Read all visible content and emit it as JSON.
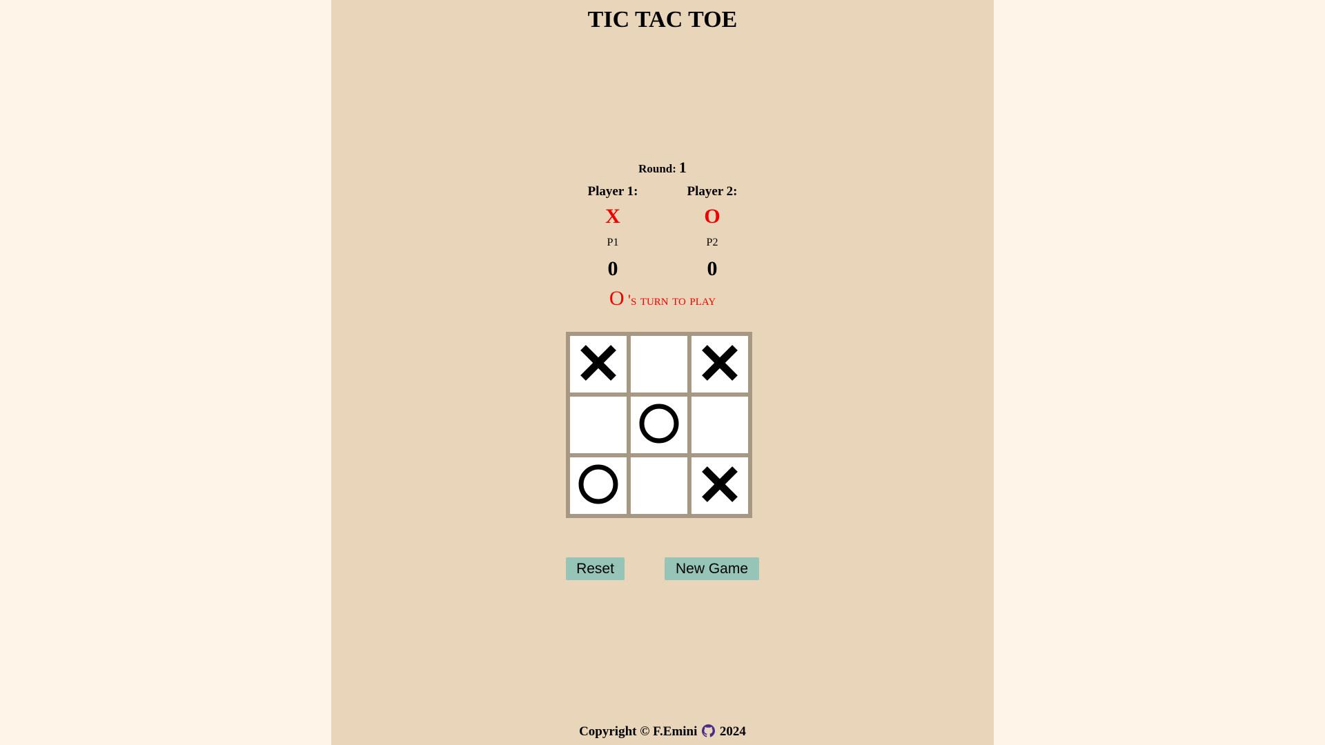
{
  "title": "TIC TAC TOE",
  "round": {
    "label": "Round:",
    "value": "1"
  },
  "players": [
    {
      "label": "Player 1:",
      "symbol": "X",
      "name": "P1",
      "score": "0"
    },
    {
      "label": "Player 2:",
      "symbol": "O",
      "name": "P2",
      "score": "0"
    }
  ],
  "turn": {
    "symbol": "O",
    "text": " 's turn to play"
  },
  "board": [
    [
      "X",
      "",
      "X"
    ],
    [
      "",
      "O",
      ""
    ],
    [
      "O",
      "",
      "X"
    ]
  ],
  "buttons": {
    "reset": "Reset",
    "new_game": "New Game"
  },
  "footer": {
    "prefix": "Copyright © F.Emini",
    "icon": "github-icon",
    "year": "2024"
  },
  "colors": {
    "page_bg": "#fff4e7",
    "panel_bg": "#e9d6ba",
    "accent_red": "#ee0000",
    "board_border": "#a79883",
    "button_bg": "#96c4b7",
    "github_purple": "#4b2a8a"
  }
}
